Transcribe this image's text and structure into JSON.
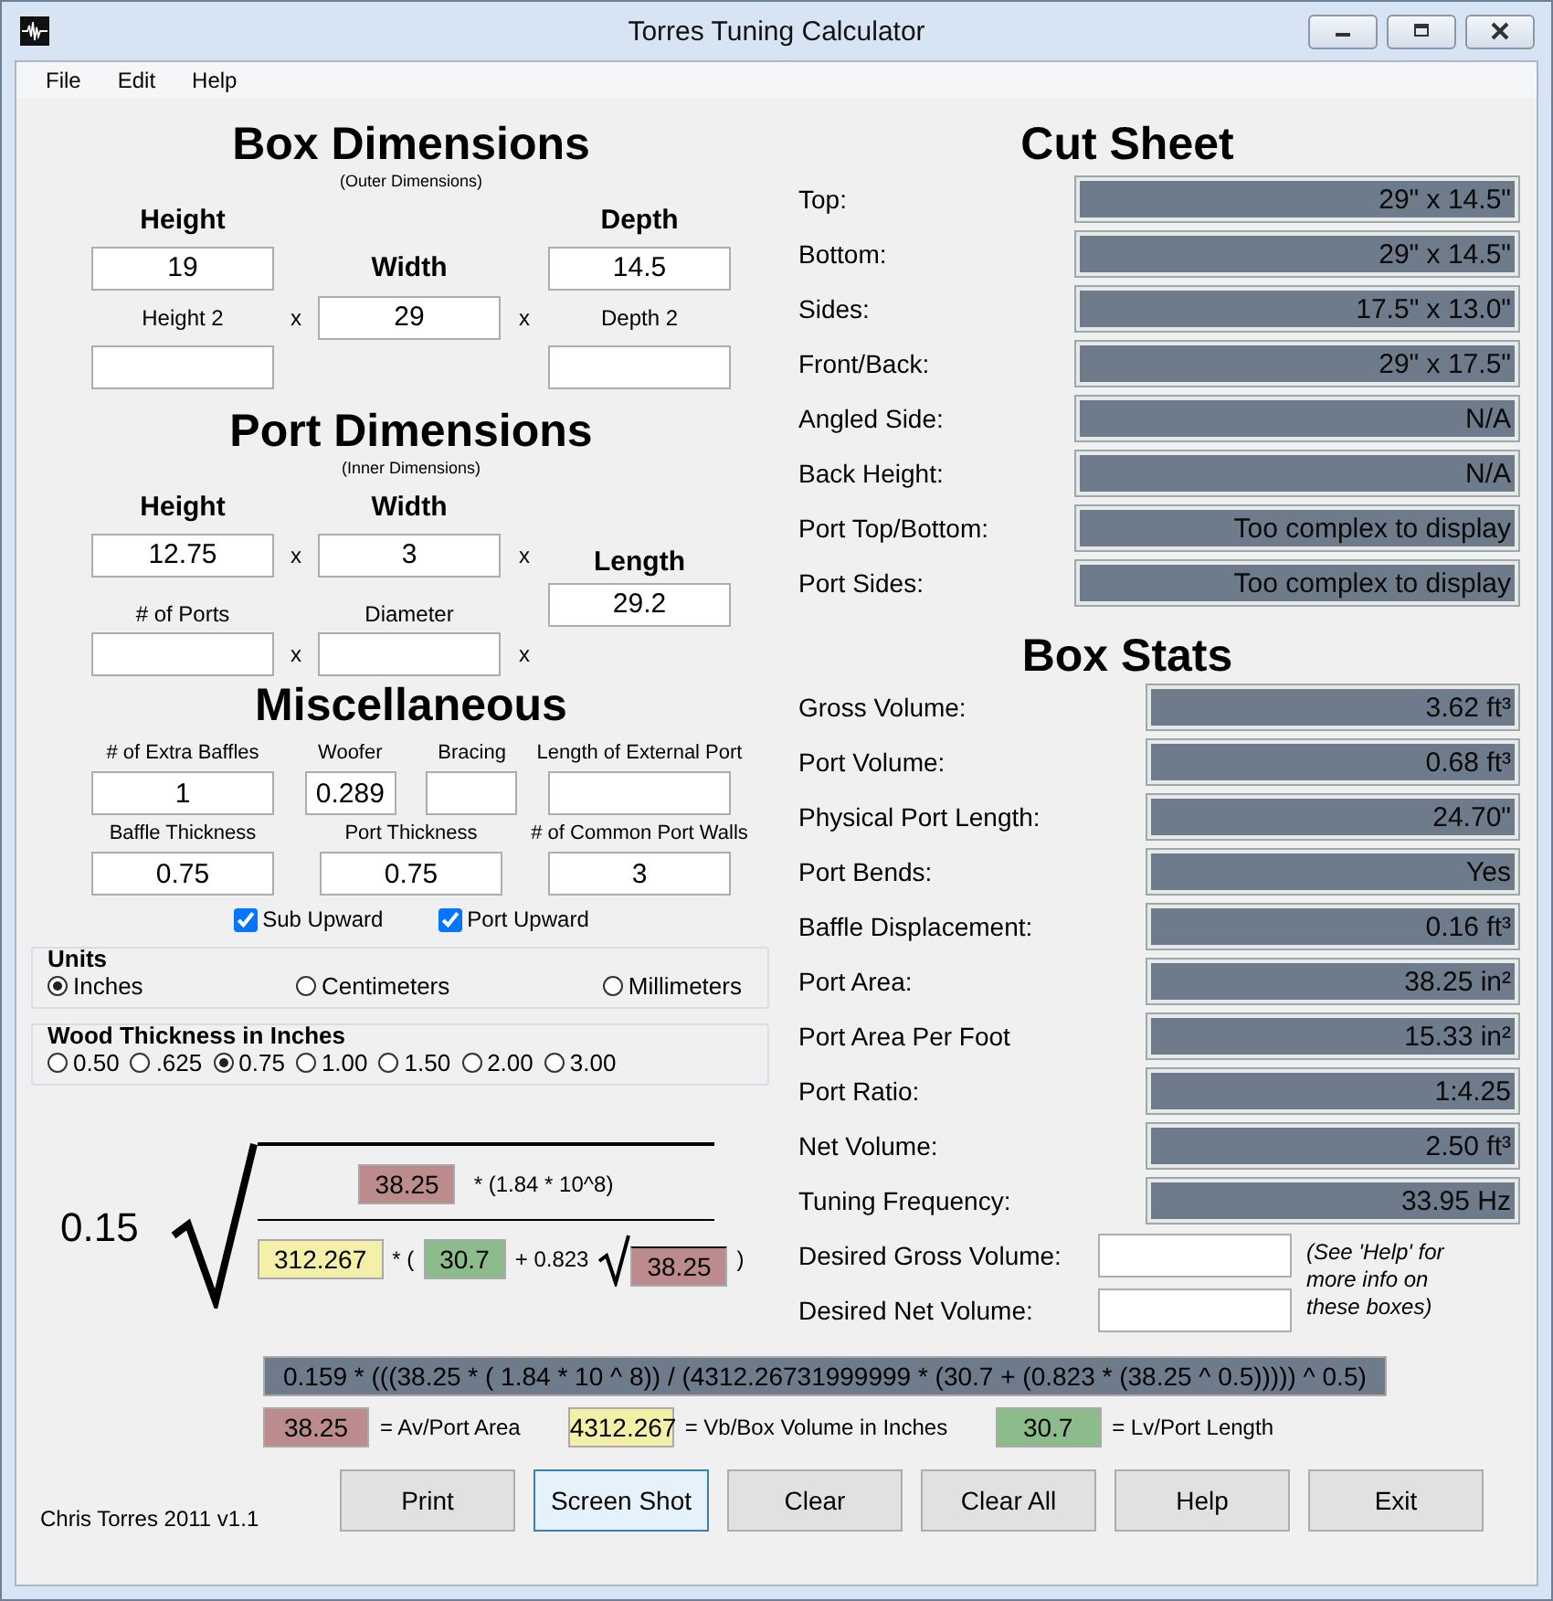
{
  "window": {
    "title": "Torres Tuning Calculator"
  },
  "menu": [
    "File",
    "Edit",
    "Help"
  ],
  "box_dimensions": {
    "title": "Box Dimensions",
    "subtitle": "(Outer Dimensions)",
    "height": {
      "label": "Height",
      "value": "19"
    },
    "width": {
      "label": "Width",
      "value": "29"
    },
    "depth": {
      "label": "Depth",
      "value": "14.5"
    },
    "height2": {
      "label": "Height 2"
    },
    "depth2": {
      "label": "Depth 2"
    },
    "multiply_signs": [
      "x",
      "x"
    ]
  },
  "port_dimensions": {
    "title": "Port Dimensions",
    "subtitle": "(Inner Dimensions)",
    "height": {
      "label": "Height",
      "value": "12.75"
    },
    "width": {
      "label": "Width",
      "value": "3"
    },
    "length": {
      "label": "Length",
      "value": "29.2"
    },
    "ports": {
      "label": "# of Ports"
    },
    "diameter": {
      "label": "Diameter"
    },
    "multiply_signs_top": [
      "x",
      "x"
    ],
    "multiply_signs_bottom": [
      "x",
      "x"
    ]
  },
  "miscellaneous": {
    "title": "Miscellaneous",
    "fields": [
      {
        "label": "# of Extra Baffles",
        "value": "1",
        "kind": "wide"
      },
      {
        "label": "Woofer",
        "value": "0.289",
        "kind": "narrow"
      },
      {
        "label": "Bracing",
        "kind": "narrow"
      },
      {
        "label": "Length of External Port",
        "kind": "wide"
      },
      {
        "label": "Baffle Thickness",
        "value": "0.75",
        "kind": "wide"
      },
      {
        "label": "Port Thickness",
        "value": "0.75",
        "kind": "wide"
      },
      {
        "label": "# of Common Port Walls",
        "value": "3",
        "kind": "wide"
      }
    ],
    "checkboxes": [
      {
        "label": "Sub Upward",
        "checked": true
      },
      {
        "label": "Port Upward",
        "checked": true
      }
    ]
  },
  "units": {
    "title": "Units",
    "options": [
      {
        "label": "Inches",
        "selected": true
      },
      {
        "label": "Centimeters",
        "selected": false
      },
      {
        "label": "Millimeters",
        "selected": false
      }
    ]
  },
  "wood_thickness": {
    "title": "Wood Thickness in Inches",
    "options": [
      {
        "label": "0.50",
        "selected": false
      },
      {
        "label": ".625",
        "selected": false
      },
      {
        "label": "0.75",
        "selected": true
      },
      {
        "label": "1.00",
        "selected": false
      },
      {
        "label": "1.50",
        "selected": false
      },
      {
        "label": "2.00",
        "selected": false
      },
      {
        "label": "3.00",
        "selected": false
      }
    ]
  },
  "formula": {
    "coefficient": "0.15",
    "numerator": [
      {
        "kind": "box",
        "text": "38.25",
        "color": "#bc8c8c"
      },
      {
        "kind": "text",
        "text": "* (1.84 * 10^8)"
      }
    ],
    "denominator": [
      {
        "kind": "box",
        "text": "312.267",
        "color": "#f4f0aa"
      },
      {
        "kind": "text",
        "text": "* ("
      },
      {
        "kind": "box",
        "text": "30.7",
        "color": "#8cbc8c"
      },
      {
        "kind": "text",
        "text": "+ 0.823"
      },
      {
        "kind": "root",
        "text": "38.25",
        "color": "#bc8c8c"
      },
      {
        "kind": "text",
        "text": ")"
      }
    ],
    "expression": "0.159 * (((38.25 * ( 1.84 * 10 ^ 8)) / (4312.26731999999 * (30.7 + (0.823 * (38.25 ^ 0.5))))) ^ 0.5)",
    "legend": [
      {
        "value": "38.25",
        "label": "= Av/Port Area",
        "color": "#bc8c8c"
      },
      {
        "value": "4312.267",
        "label": "= Vb/Box Volume in Inches",
        "color": "#f4f0aa"
      },
      {
        "value": "30.7",
        "label": "= Lv/Port Length",
        "color": "#8cbc8c"
      }
    ]
  },
  "cut_sheet": {
    "title": "Cut Sheet",
    "rows": [
      {
        "label": "Top:",
        "value": "29\" x 14.5\""
      },
      {
        "label": "Bottom:",
        "value": "29\" x 14.5\""
      },
      {
        "label": "Sides:",
        "value": "17.5\" x 13.0\""
      },
      {
        "label": "Front/Back:",
        "value": "29\" x 17.5\""
      },
      {
        "label": "Angled Side:",
        "value": "N/A"
      },
      {
        "label": "Back Height:",
        "value": "N/A"
      },
      {
        "label": "Port Top/Bottom:",
        "value": "Too complex to display"
      },
      {
        "label": "Port Sides:",
        "value": "Too complex to display"
      }
    ]
  },
  "box_stats": {
    "title": "Box Stats",
    "rows": [
      {
        "label": "Gross Volume:",
        "value": "3.62 ft³"
      },
      {
        "label": "Port Volume:",
        "value": "0.68 ft³"
      },
      {
        "label": "Physical Port Length:",
        "value": "24.70\""
      },
      {
        "label": "Port Bends:",
        "value": "Yes"
      },
      {
        "label": "Baffle Displacement:",
        "value": "0.16 ft³"
      },
      {
        "label": "Port Area:",
        "value": "38.25 in²"
      },
      {
        "label": "Port Area Per Foot",
        "value": "15.33 in²"
      },
      {
        "label": "Port Ratio:",
        "value": "1:4.25"
      },
      {
        "label": "Net Volume:",
        "value": "2.50 ft³"
      },
      {
        "label": "Tuning Frequency:",
        "value": "33.95 Hz"
      }
    ],
    "inputs": [
      {
        "label": "Desired Gross Volume:"
      },
      {
        "label": "Desired Net Volume:"
      }
    ],
    "note": "(See 'Help' for more info on these boxes)"
  },
  "footer": {
    "credit": "Chris Torres 2011 v1.1"
  },
  "buttons": [
    {
      "label": "Print",
      "focused": false
    },
    {
      "label": "Screen Shot",
      "focused": true
    },
    {
      "label": "Clear",
      "focused": false
    },
    {
      "label": "Clear All",
      "focused": false
    },
    {
      "label": "Help",
      "focused": false
    },
    {
      "label": "Exit",
      "focused": false
    }
  ]
}
